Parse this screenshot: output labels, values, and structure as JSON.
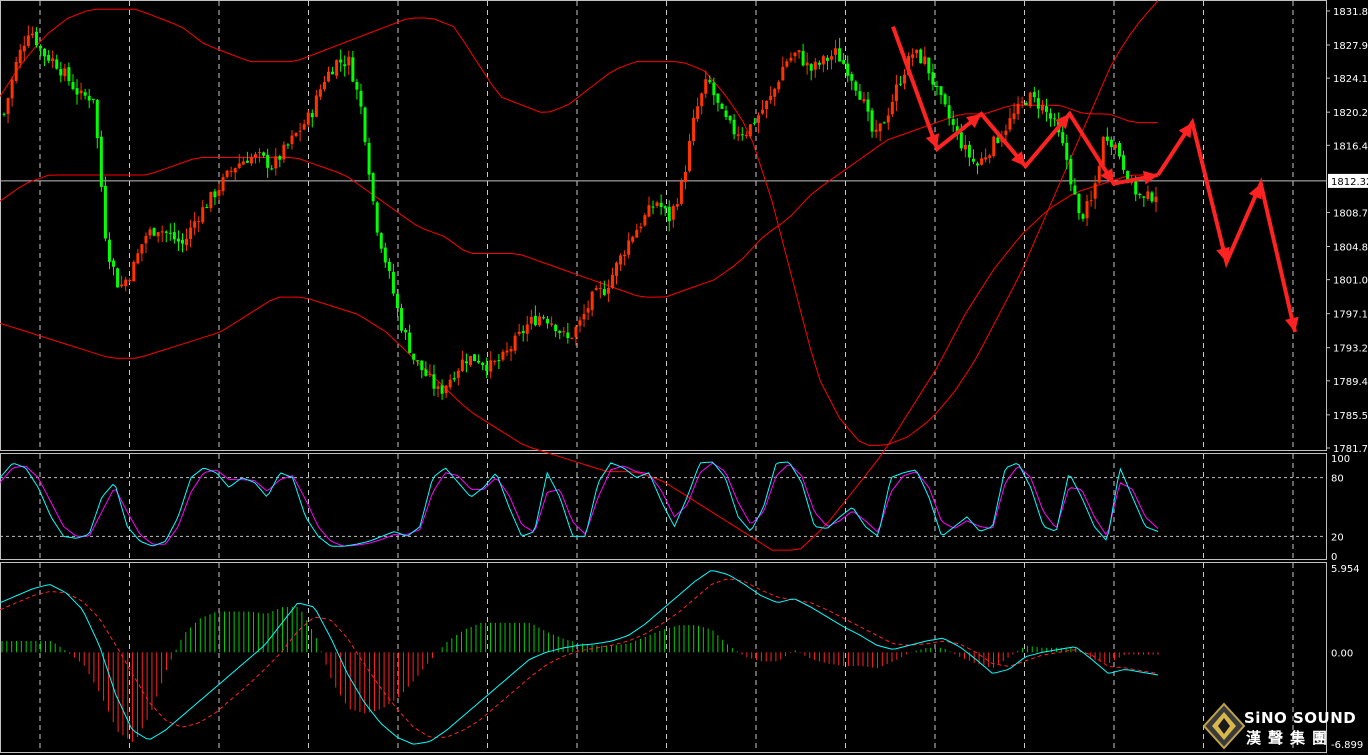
{
  "chart_data": [
    {
      "type": "candlestick",
      "panel": "price",
      "y_ticks": [
        "1831.80",
        "1827.90",
        "1824.10",
        "1820.20",
        "1816.40",
        "1812.32",
        "1808.70",
        "1804.80",
        "1801.00",
        "1797.10",
        "1793.20",
        "1789.40",
        "1785.50",
        "1781.70"
      ],
      "ylim": [
        1781.7,
        1832.6
      ],
      "current_price": 1812.32,
      "current_price_label": "1812.32",
      "grid": "dashed vertical",
      "colors": {
        "up": "#ff3300",
        "down": "#00ff00",
        "bands": "#ff0000",
        "arrows": "#ff2222",
        "price_line": "#c0c0c0"
      },
      "close_series": [
        1820,
        1826,
        1830,
        1827,
        1826,
        1824,
        1822,
        1822,
        1805,
        1800,
        1802,
        1806,
        1807,
        1806,
        1805,
        1808,
        1810,
        1812,
        1814,
        1815,
        1815,
        1814,
        1816,
        1818,
        1820,
        1824,
        1826,
        1826,
        1820,
        1808,
        1802,
        1796,
        1792,
        1790,
        1788,
        1790,
        1792,
        1792,
        1791,
        1792,
        1794,
        1796,
        1797,
        1796,
        1794,
        1796,
        1799,
        1800,
        1803,
        1806,
        1808,
        1810,
        1808,
        1812,
        1820,
        1824,
        1820,
        1818,
        1818,
        1820,
        1822,
        1826,
        1827,
        1825,
        1826,
        1827,
        1825,
        1822,
        1817,
        1820,
        1824,
        1827,
        1826,
        1822,
        1819,
        1816,
        1814,
        1816,
        1818,
        1820,
        1822,
        1821,
        1819,
        1815,
        1808,
        1810,
        1818,
        1816,
        1812,
        1810,
        1811
      ],
      "bollinger": {
        "upper": [
          1822,
          1826,
          1829,
          1831,
          1832,
          1832,
          1832,
          1831,
          1830,
          1828,
          1827,
          1826,
          1826,
          1826,
          1827,
          1828,
          1829,
          1830,
          1831,
          1831,
          1830,
          1826,
          1822,
          1821,
          1820,
          1821,
          1823,
          1825,
          1826,
          1826,
          1826,
          1825,
          1822,
          1818,
          1810,
          1800,
          1790,
          1785,
          1782,
          1782,
          1783,
          1785,
          1788,
          1792,
          1797,
          1802,
          1808,
          1814,
          1820,
          1826,
          1830,
          1833
        ],
        "middle": [
          1810,
          1812,
          1813,
          1813,
          1813,
          1813,
          1813,
          1814,
          1815,
          1815,
          1815,
          1815,
          1815,
          1814,
          1813,
          1811,
          1809,
          1807,
          1806,
          1804,
          1804,
          1804,
          1803,
          1802,
          1801,
          1800,
          1799,
          1799,
          1800,
          1801,
          1803,
          1806,
          1808,
          1811,
          1813,
          1815,
          1817,
          1818,
          1819,
          1820,
          1820,
          1821,
          1821,
          1821,
          1820,
          1820,
          1819,
          1819
        ],
        "lower": [
          1796,
          1795,
          1794,
          1793,
          1792,
          1792,
          1793,
          1794,
          1795,
          1797,
          1799,
          1799,
          1798,
          1797,
          1795,
          1792,
          1789,
          1786,
          1784,
          1782,
          1781,
          1780,
          1779,
          1779,
          1778,
          1776,
          1774,
          1772,
          1770,
          1770,
          1773,
          1777,
          1781,
          1786,
          1791,
          1797,
          1802,
          1806,
          1809,
          1811,
          1812,
          1813,
          1813
        ]
      },
      "annotation_zigzag": {
        "drawn": [
          1830,
          1816,
          1820,
          1814,
          1820,
          1812,
          1813
        ],
        "projection": [
          1813,
          1819,
          1803,
          1812,
          1795
        ]
      }
    },
    {
      "type": "line",
      "panel": "stochastic",
      "y_ticks": [
        "100",
        "80",
        "20",
        "0"
      ],
      "ylim": [
        0,
        100
      ],
      "levels": [
        80,
        20
      ],
      "colors": {
        "main": "#00ffff",
        "signal": "#ff00ff",
        "level": "#c0c0c0"
      },
      "main": [
        80,
        95,
        90,
        70,
        40,
        20,
        18,
        22,
        60,
        75,
        30,
        15,
        10,
        15,
        40,
        80,
        90,
        85,
        70,
        80,
        75,
        60,
        85,
        80,
        40,
        20,
        10,
        10,
        12,
        15,
        20,
        25,
        20,
        30,
        80,
        90,
        75,
        60,
        70,
        85,
        50,
        20,
        25,
        85,
        60,
        20,
        20,
        75,
        95,
        90,
        80,
        85,
        55,
        30,
        60,
        95,
        96,
        80,
        40,
        25,
        50,
        95,
        96,
        75,
        30,
        28,
        40,
        50,
        30,
        20,
        80,
        85,
        88,
        60,
        20,
        30,
        40,
        25,
        30,
        90,
        95,
        70,
        30,
        25,
        85,
        60,
        30,
        15,
        90,
        60,
        30,
        25
      ],
      "signal": [
        75,
        90,
        92,
        80,
        55,
        30,
        20,
        20,
        45,
        70,
        45,
        22,
        12,
        12,
        30,
        65,
        85,
        88,
        78,
        78,
        77,
        66,
        78,
        82,
        58,
        30,
        15,
        10,
        11,
        13,
        17,
        22,
        22,
        27,
        65,
        85,
        82,
        68,
        68,
        80,
        62,
        32,
        24,
        65,
        68,
        35,
        22,
        60,
        88,
        92,
        86,
        84,
        66,
        40,
        52,
        85,
        95,
        86,
        55,
        32,
        45,
        82,
        94,
        82,
        45,
        30,
        36,
        46,
        36,
        24,
        65,
        82,
        86,
        70,
        35,
        28,
        36,
        30,
        28,
        75,
        92,
        80,
        45,
        28,
        70,
        68,
        40,
        20,
        75,
        68,
        40,
        28
      ]
    },
    {
      "type": "line+bar",
      "panel": "macd",
      "y_ticks": [
        "5.954",
        "0.00",
        "-6.899"
      ],
      "ylim": [
        -6.899,
        5.954
      ],
      "colors": {
        "macd": "#00ffff",
        "signal": "#ff2222",
        "hist_pos": "#00cc00",
        "hist_neg": "#ff2222"
      },
      "macd": [
        3.5,
        4,
        4.5,
        4.8,
        4.2,
        3.0,
        0.5,
        -3,
        -5.5,
        -6.2,
        -5.5,
        -4.5,
        -3.5,
        -2.5,
        -1.5,
        -0.5,
        0.5,
        2,
        3.5,
        3.2,
        1,
        -1.5,
        -3.5,
        -5,
        -6,
        -6.5,
        -6.3,
        -5.5,
        -4.5,
        -3.5,
        -2.5,
        -1.5,
        -0.5,
        0,
        0.3,
        0.5,
        0.6,
        0.8,
        1.2,
        2,
        3,
        4,
        5,
        5.8,
        5.5,
        4.8,
        4,
        3.5,
        3.8,
        3.2,
        2.5,
        1.8,
        1.2,
        0.5,
        0.2,
        0.5,
        0.8,
        1,
        0.4,
        -0.5,
        -1.5,
        -1.2,
        -0.3,
        0,
        0.2,
        0.4,
        -0.5,
        -1.5,
        -1.2,
        -1.4,
        -1.6
      ],
      "signal": [
        3,
        3.5,
        4,
        4.3,
        4.2,
        3.6,
        2.4,
        0.5,
        -1.5,
        -3.5,
        -4.8,
        -5.3,
        -5,
        -4.3,
        -3.3,
        -2.3,
        -1.2,
        0,
        1.5,
        2.5,
        2.3,
        1,
        -0.8,
        -2.5,
        -4,
        -5.3,
        -6,
        -6,
        -5.5,
        -4.8,
        -3.8,
        -2.8,
        -1.8,
        -0.9,
        -0.3,
        0.1,
        0.3,
        0.5,
        0.8,
        1.3,
        2,
        2.8,
        3.8,
        4.8,
        5.2,
        5,
        4.4,
        3.9,
        3.7,
        3.5,
        3,
        2.4,
        1.8,
        1.2,
        0.6,
        0.5,
        0.6,
        0.8,
        0.6,
        0,
        -0.8,
        -1,
        -0.6,
        -0.2,
        0,
        0.2,
        -0.2,
        -1,
        -1.1,
        -1.3,
        -1.5
      ]
    }
  ],
  "logo": {
    "name_en": "SiNO SOUND",
    "name_cn": "漢聲集團"
  }
}
